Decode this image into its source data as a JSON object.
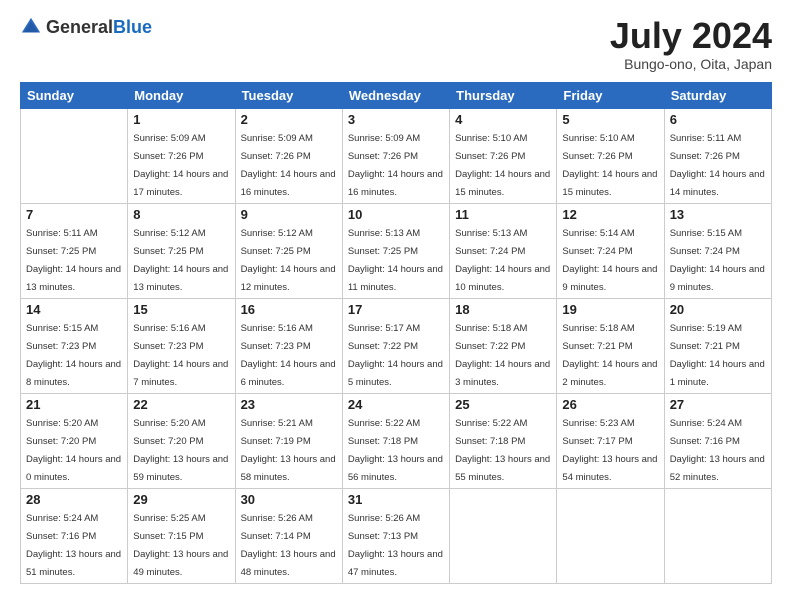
{
  "logo": {
    "general": "General",
    "blue": "Blue"
  },
  "title": "July 2024",
  "subtitle": "Bungo-ono, Oita, Japan",
  "days": [
    "Sunday",
    "Monday",
    "Tuesday",
    "Wednesday",
    "Thursday",
    "Friday",
    "Saturday"
  ],
  "weeks": [
    [
      {
        "date": "",
        "sunrise": "",
        "sunset": "",
        "daylight": ""
      },
      {
        "date": "1",
        "sunrise": "Sunrise: 5:09 AM",
        "sunset": "Sunset: 7:26 PM",
        "daylight": "Daylight: 14 hours and 17 minutes."
      },
      {
        "date": "2",
        "sunrise": "Sunrise: 5:09 AM",
        "sunset": "Sunset: 7:26 PM",
        "daylight": "Daylight: 14 hours and 16 minutes."
      },
      {
        "date": "3",
        "sunrise": "Sunrise: 5:09 AM",
        "sunset": "Sunset: 7:26 PM",
        "daylight": "Daylight: 14 hours and 16 minutes."
      },
      {
        "date": "4",
        "sunrise": "Sunrise: 5:10 AM",
        "sunset": "Sunset: 7:26 PM",
        "daylight": "Daylight: 14 hours and 15 minutes."
      },
      {
        "date": "5",
        "sunrise": "Sunrise: 5:10 AM",
        "sunset": "Sunset: 7:26 PM",
        "daylight": "Daylight: 14 hours and 15 minutes."
      },
      {
        "date": "6",
        "sunrise": "Sunrise: 5:11 AM",
        "sunset": "Sunset: 7:26 PM",
        "daylight": "Daylight: 14 hours and 14 minutes."
      }
    ],
    [
      {
        "date": "7",
        "sunrise": "Sunrise: 5:11 AM",
        "sunset": "Sunset: 7:25 PM",
        "daylight": "Daylight: 14 hours and 13 minutes."
      },
      {
        "date": "8",
        "sunrise": "Sunrise: 5:12 AM",
        "sunset": "Sunset: 7:25 PM",
        "daylight": "Daylight: 14 hours and 13 minutes."
      },
      {
        "date": "9",
        "sunrise": "Sunrise: 5:12 AM",
        "sunset": "Sunset: 7:25 PM",
        "daylight": "Daylight: 14 hours and 12 minutes."
      },
      {
        "date": "10",
        "sunrise": "Sunrise: 5:13 AM",
        "sunset": "Sunset: 7:25 PM",
        "daylight": "Daylight: 14 hours and 11 minutes."
      },
      {
        "date": "11",
        "sunrise": "Sunrise: 5:13 AM",
        "sunset": "Sunset: 7:24 PM",
        "daylight": "Daylight: 14 hours and 10 minutes."
      },
      {
        "date": "12",
        "sunrise": "Sunrise: 5:14 AM",
        "sunset": "Sunset: 7:24 PM",
        "daylight": "Daylight: 14 hours and 9 minutes."
      },
      {
        "date": "13",
        "sunrise": "Sunrise: 5:15 AM",
        "sunset": "Sunset: 7:24 PM",
        "daylight": "Daylight: 14 hours and 9 minutes."
      }
    ],
    [
      {
        "date": "14",
        "sunrise": "Sunrise: 5:15 AM",
        "sunset": "Sunset: 7:23 PM",
        "daylight": "Daylight: 14 hours and 8 minutes."
      },
      {
        "date": "15",
        "sunrise": "Sunrise: 5:16 AM",
        "sunset": "Sunset: 7:23 PM",
        "daylight": "Daylight: 14 hours and 7 minutes."
      },
      {
        "date": "16",
        "sunrise": "Sunrise: 5:16 AM",
        "sunset": "Sunset: 7:23 PM",
        "daylight": "Daylight: 14 hours and 6 minutes."
      },
      {
        "date": "17",
        "sunrise": "Sunrise: 5:17 AM",
        "sunset": "Sunset: 7:22 PM",
        "daylight": "Daylight: 14 hours and 5 minutes."
      },
      {
        "date": "18",
        "sunrise": "Sunrise: 5:18 AM",
        "sunset": "Sunset: 7:22 PM",
        "daylight": "Daylight: 14 hours and 3 minutes."
      },
      {
        "date": "19",
        "sunrise": "Sunrise: 5:18 AM",
        "sunset": "Sunset: 7:21 PM",
        "daylight": "Daylight: 14 hours and 2 minutes."
      },
      {
        "date": "20",
        "sunrise": "Sunrise: 5:19 AM",
        "sunset": "Sunset: 7:21 PM",
        "daylight": "Daylight: 14 hours and 1 minute."
      }
    ],
    [
      {
        "date": "21",
        "sunrise": "Sunrise: 5:20 AM",
        "sunset": "Sunset: 7:20 PM",
        "daylight": "Daylight: 14 hours and 0 minutes."
      },
      {
        "date": "22",
        "sunrise": "Sunrise: 5:20 AM",
        "sunset": "Sunset: 7:20 PM",
        "daylight": "Daylight: 13 hours and 59 minutes."
      },
      {
        "date": "23",
        "sunrise": "Sunrise: 5:21 AM",
        "sunset": "Sunset: 7:19 PM",
        "daylight": "Daylight: 13 hours and 58 minutes."
      },
      {
        "date": "24",
        "sunrise": "Sunrise: 5:22 AM",
        "sunset": "Sunset: 7:18 PM",
        "daylight": "Daylight: 13 hours and 56 minutes."
      },
      {
        "date": "25",
        "sunrise": "Sunrise: 5:22 AM",
        "sunset": "Sunset: 7:18 PM",
        "daylight": "Daylight: 13 hours and 55 minutes."
      },
      {
        "date": "26",
        "sunrise": "Sunrise: 5:23 AM",
        "sunset": "Sunset: 7:17 PM",
        "daylight": "Daylight: 13 hours and 54 minutes."
      },
      {
        "date": "27",
        "sunrise": "Sunrise: 5:24 AM",
        "sunset": "Sunset: 7:16 PM",
        "daylight": "Daylight: 13 hours and 52 minutes."
      }
    ],
    [
      {
        "date": "28",
        "sunrise": "Sunrise: 5:24 AM",
        "sunset": "Sunset: 7:16 PM",
        "daylight": "Daylight: 13 hours and 51 minutes."
      },
      {
        "date": "29",
        "sunrise": "Sunrise: 5:25 AM",
        "sunset": "Sunset: 7:15 PM",
        "daylight": "Daylight: 13 hours and 49 minutes."
      },
      {
        "date": "30",
        "sunrise": "Sunrise: 5:26 AM",
        "sunset": "Sunset: 7:14 PM",
        "daylight": "Daylight: 13 hours and 48 minutes."
      },
      {
        "date": "31",
        "sunrise": "Sunrise: 5:26 AM",
        "sunset": "Sunset: 7:13 PM",
        "daylight": "Daylight: 13 hours and 47 minutes."
      },
      {
        "date": "",
        "sunrise": "",
        "sunset": "",
        "daylight": ""
      },
      {
        "date": "",
        "sunrise": "",
        "sunset": "",
        "daylight": ""
      },
      {
        "date": "",
        "sunrise": "",
        "sunset": "",
        "daylight": ""
      }
    ]
  ]
}
